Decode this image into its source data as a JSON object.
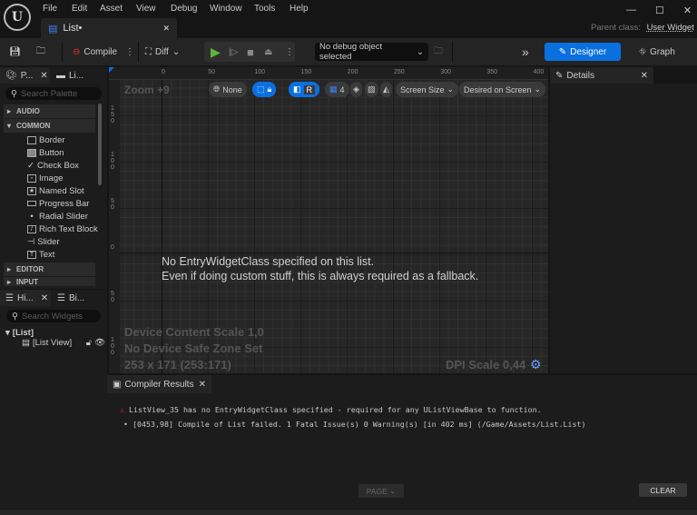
{
  "menu": [
    "File",
    "Edit",
    "Asset",
    "View",
    "Debug",
    "Window",
    "Tools",
    "Help"
  ],
  "tab": {
    "label": "List•"
  },
  "parent_class": {
    "label": "Parent class:",
    "value": "User Widget"
  },
  "toolbar": {
    "compile": "Compile",
    "diff": "Diff",
    "debug_object": "No debug object selected",
    "designer": "Designer",
    "graph": "Graph"
  },
  "palette": {
    "tab": "P...",
    "tab2": "Li...",
    "search_placeholder": "Search Palette",
    "categories": [
      "AUDIO",
      "COMMON",
      "EDITOR",
      "INPUT"
    ],
    "items": [
      "Border",
      "Button",
      "Check Box",
      "Image",
      "Named Slot",
      "Progress Bar",
      "Radial Slider",
      "Rich Text Block",
      "Slider",
      "Text"
    ]
  },
  "hierarchy": {
    "tab": "Hi...",
    "tab2": "Bi...",
    "search_placeholder": "Search Widgets",
    "root": "[List]",
    "child": "[List View]"
  },
  "canvas": {
    "zoom": "Zoom +9",
    "none": "None",
    "r": "R",
    "grid": "4",
    "screen_size": "Screen Size",
    "desired": "Desired on Screen",
    "ruler_x": [
      "0",
      "50",
      "100",
      "150",
      "200",
      "250",
      "300",
      "350",
      "400"
    ],
    "ruler_y": [
      "150",
      "100",
      "50",
      "0",
      "50",
      "100"
    ],
    "message1": "No EntryWidgetClass specified on this list.",
    "message2": "Even if doing custom stuff, this is always required as a fallback.",
    "device_scale": "Device Content Scale 1,0",
    "safe_zone": "No Device Safe Zone Set",
    "size": "253 x 171 (253:171)",
    "dpi": "DPI Scale 0,44"
  },
  "details": {
    "tab": "Details"
  },
  "compiler": {
    "tab": "Compiler Results",
    "messages": [
      "ListView_35 has no EntryWidgetClass specified - required for any UListViewBase to function.",
      "[0453,98] Compile of List failed. 1 Fatal Issue(s) 0 Warning(s) [in 402 ms] (/Game/Assets/List.List)"
    ],
    "page": "PAGE",
    "clear": "CLEAR"
  },
  "colors": {
    "accent": "#0a70e0",
    "play": "#5fb73a",
    "error": "#e03030"
  }
}
